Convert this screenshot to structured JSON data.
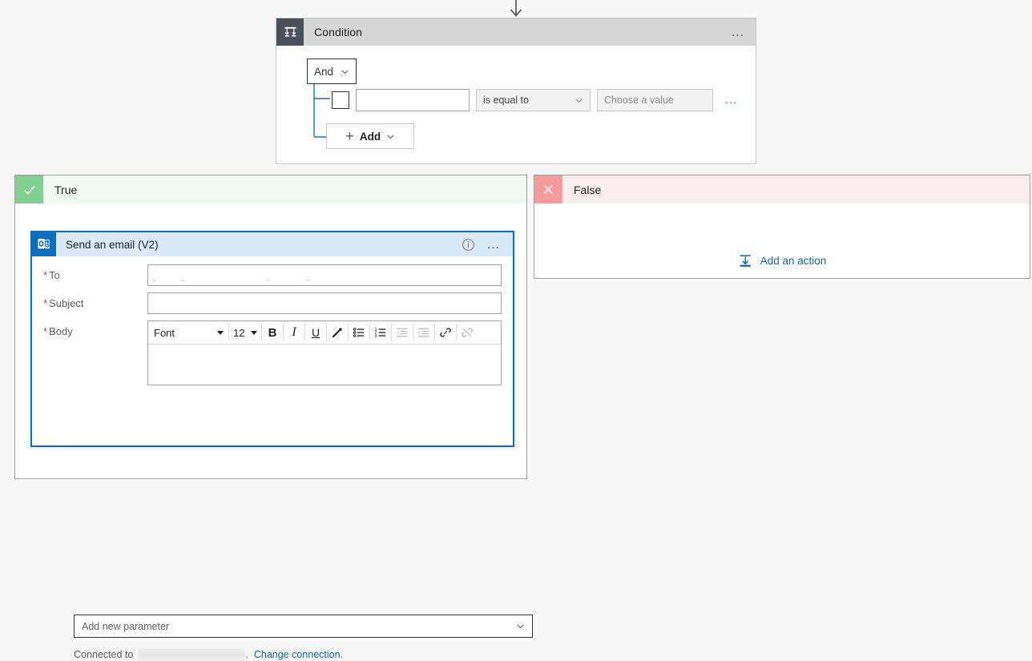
{
  "canvas": {
    "incoming_arrow": "down-arrow"
  },
  "condition_card": {
    "icon": "condition-branch-icon",
    "title": "Condition",
    "menu": "…",
    "logic_operator": {
      "value": "And",
      "chevron": "chevron-down-icon"
    },
    "row": {
      "checkbox_checked": false,
      "left_operand": "",
      "operator": "is equal to",
      "operator_chevron": "chevron-down-icon",
      "value_placeholder": "Choose a value",
      "value": "",
      "row_menu": "…"
    },
    "add_button": {
      "plus": "+",
      "label": "Add",
      "chevron": "chevron-down-icon"
    }
  },
  "branches": {
    "true": {
      "badge_icon": "checkmark-icon",
      "title": "True",
      "badge_color": "#81d092",
      "header_bg": "#eef9f0"
    },
    "false": {
      "badge_icon": "close-x-icon",
      "title": "False",
      "badge_color": "#f79d9d",
      "header_bg": "#fdeeee",
      "add_action": {
        "icon": "insert-action-icon",
        "label": "Add an action"
      }
    }
  },
  "email_card": {
    "icon": "outlook-icon",
    "title": "Send an email (V2)",
    "info_icon": "info-circle-icon",
    "menu": "…",
    "accent_color": "#0f6cbd",
    "fields": {
      "to": {
        "label": "To",
        "required": true,
        "value": "",
        "placeholder": ""
      },
      "subject": {
        "label": "Subject",
        "required": true,
        "value": "",
        "placeholder": ""
      },
      "body": {
        "label": "Body",
        "required": true,
        "value": ""
      }
    },
    "rich_text_toolbar": {
      "font_name": "Font",
      "font_size": "12",
      "buttons": [
        {
          "name": "bold-icon",
          "glyph": "B",
          "disabled": false
        },
        {
          "name": "italic-icon",
          "glyph": "I",
          "disabled": false
        },
        {
          "name": "underline-icon",
          "glyph": "U",
          "disabled": false
        },
        {
          "name": "highlighter-icon",
          "glyph": "",
          "disabled": false
        },
        {
          "name": "bulleted-list-icon",
          "glyph": "",
          "disabled": false
        },
        {
          "name": "numbered-list-icon",
          "glyph": "",
          "disabled": false
        },
        {
          "name": "decrease-indent-icon",
          "glyph": "",
          "disabled": true
        },
        {
          "name": "increase-indent-icon",
          "glyph": "",
          "disabled": true
        },
        {
          "name": "link-icon",
          "glyph": "",
          "disabled": false
        },
        {
          "name": "unlink-icon",
          "glyph": "",
          "disabled": true
        }
      ]
    },
    "add_parameter": {
      "label": "Add new parameter",
      "chevron": "chevron-down-icon"
    },
    "connection": {
      "prefix": "Connected to",
      "account": "",
      "suffix": ".",
      "change_link": "Change connection."
    }
  }
}
